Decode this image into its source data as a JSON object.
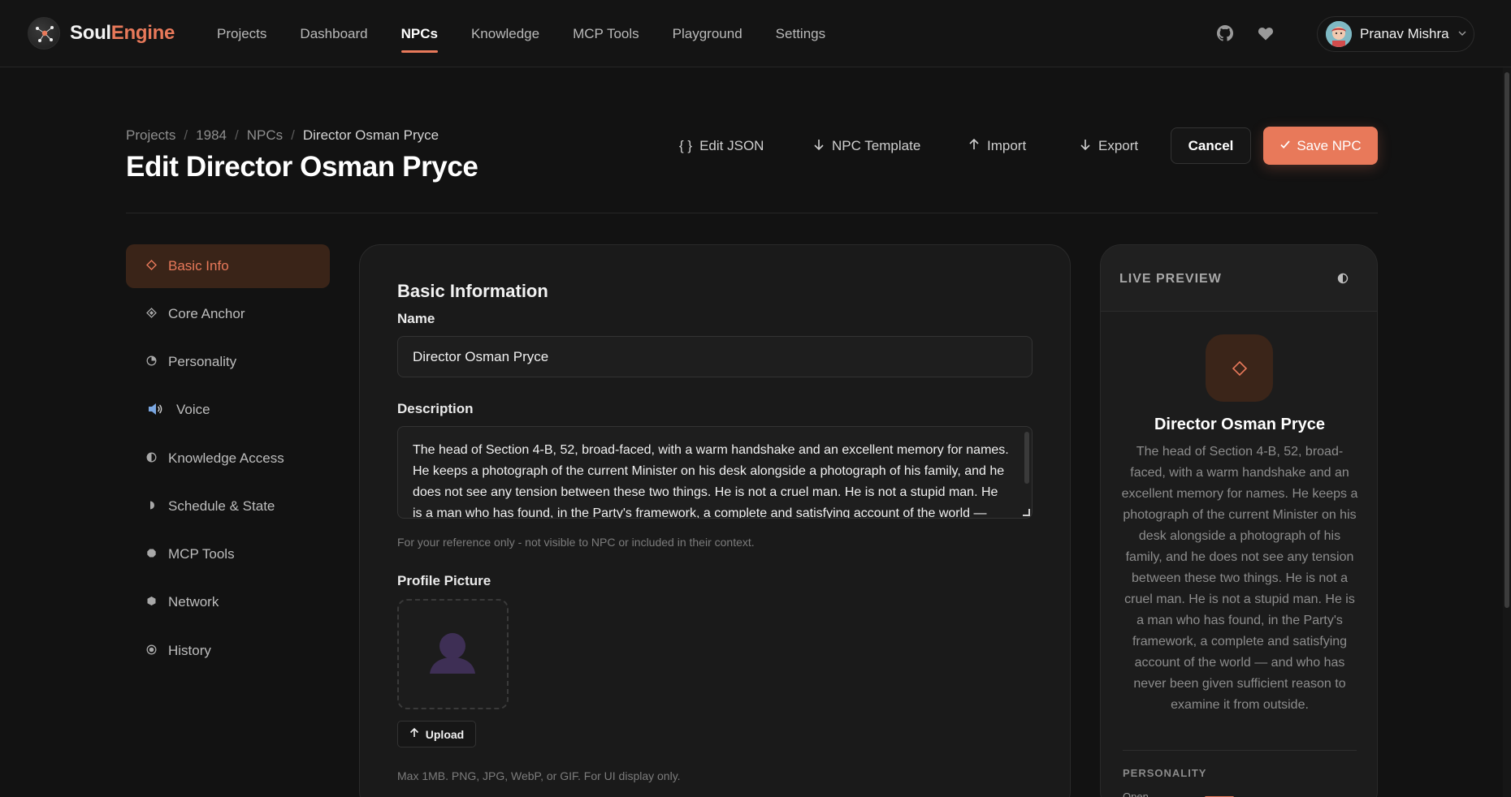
{
  "brand": {
    "part1": "Soul",
    "part2": "Engine"
  },
  "nav": {
    "links": [
      "Projects",
      "Dashboard",
      "NPCs",
      "Knowledge",
      "MCP Tools",
      "Playground",
      "Settings"
    ],
    "active": "NPCs",
    "icons": [
      "github-icon",
      "heart-icon"
    ]
  },
  "user": {
    "name": "Pranav Mishra"
  },
  "breadcrumb": [
    "Projects",
    "1984",
    "NPCs",
    "Director Osman Pryce"
  ],
  "page": {
    "title": "Edit Director Osman Pryce"
  },
  "toolbar": {
    "edit_json": "Edit JSON",
    "npc_template": "NPC Template",
    "import": "Import",
    "export": "Export",
    "cancel": "Cancel",
    "save": "Save NPC"
  },
  "sidebar": {
    "items": [
      {
        "label": "Basic Info",
        "icon": "diamond-outline-icon"
      },
      {
        "label": "Core Anchor",
        "icon": "diamond-filled-icon"
      },
      {
        "label": "Personality",
        "icon": "pie-icon"
      },
      {
        "label": "Voice",
        "icon": "speaker-icon"
      },
      {
        "label": "Knowledge Access",
        "icon": "half-circle-icon"
      },
      {
        "label": "Schedule & State",
        "icon": "half-moon-icon"
      },
      {
        "label": "MCP Tools",
        "icon": "octagon-icon"
      },
      {
        "label": "Network",
        "icon": "hexagon-icon"
      },
      {
        "label": "History",
        "icon": "target-icon"
      }
    ],
    "active": "Basic Info"
  },
  "form": {
    "section_title": "Basic Information",
    "name_label": "Name",
    "name_value": "Director Osman Pryce",
    "description_label": "Description",
    "description_value": "The head of Section 4-B, 52, broad-faced, with a warm handshake and an excellent memory for names. He keeps a photograph of the current Minister on his desk alongside a photograph of his family, and he does not see any tension between these two things. He is not a cruel man. He is not a stupid man. He is a man who has found, in the Party's framework, a complete and satisfying account of the world — and who has never been given sufficient reason to examine it from outside.",
    "description_help": "For your reference only - not visible to NPC or included in their context.",
    "picture_label": "Profile Picture",
    "upload_label": "Upload",
    "upload_help": "Max 1MB. PNG, JPG, WebP, or GIF. For UI display only."
  },
  "preview": {
    "title": "LIVE PREVIEW",
    "name": "Director Osman Pryce",
    "description": "The head of Section 4-B, 52, broad-faced, with a warm handshake and an excellent memory for names. He keeps a photograph of the current Minister on his desk alongside a photograph of his family, and he does not see any tension between these two things. He is not a cruel man. He is not a stupid man. He is a man who has found, in the Party's framework, a complete and satisfying account of the world — and who has never been given sufficient reason to examine it from outside.",
    "section_label": "PERSONALITY",
    "trait_label": "Open"
  },
  "colors": {
    "accent": "#e8795a",
    "background": "#121212",
    "card": "#1a1a1a",
    "active_bg": "#3a2418"
  }
}
